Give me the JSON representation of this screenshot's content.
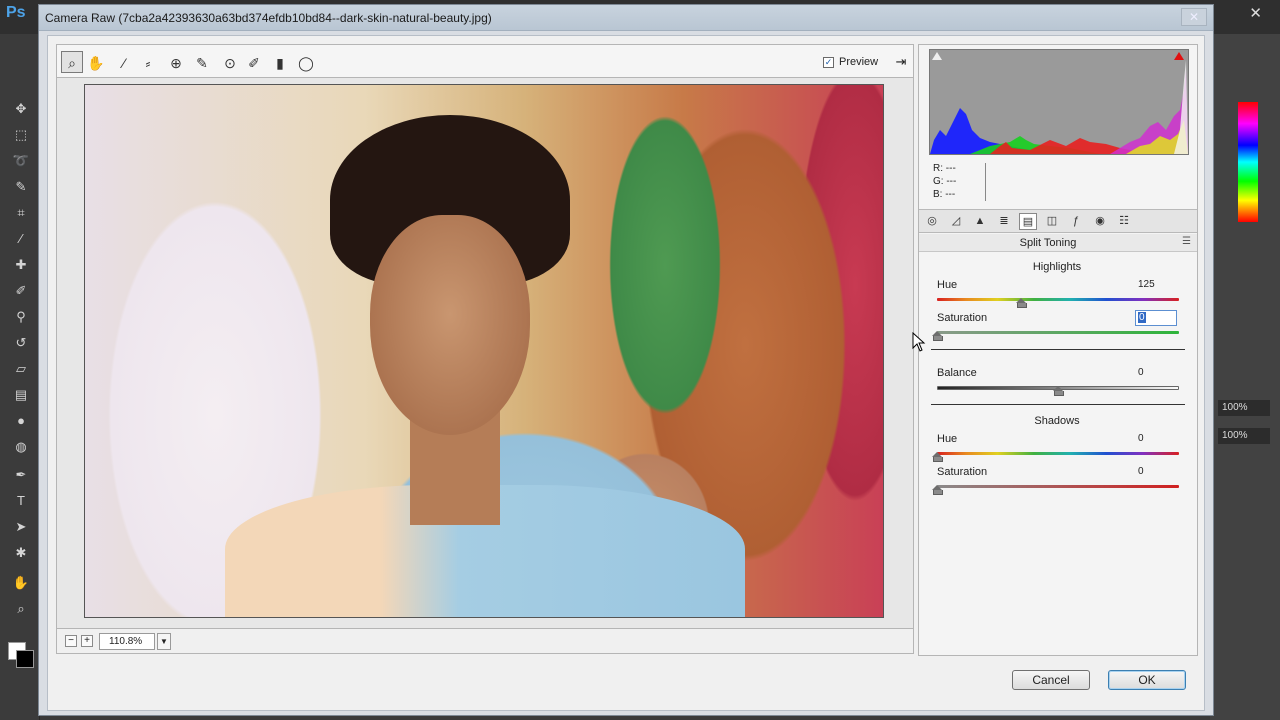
{
  "app": {
    "logo": "Ps",
    "window_close": "✕",
    "percent_1": "100%",
    "percent_2": "100%"
  },
  "dialog": {
    "title": "Camera Raw (7cba2a42393630a63bd374efdb10bd84--dark-skin-natural-beauty.jpg)",
    "close_glyph": "✕"
  },
  "toolbar": {
    "tools": [
      "zoom-icon",
      "hand-icon",
      "white-balance-icon",
      "color-sampler-icon",
      "targeted-adjustment-icon",
      "straighten-icon",
      "spot-removal-icon",
      "adjustment-brush-icon",
      "graduated-filter-icon",
      "radial-filter-icon"
    ],
    "preview_checked": true,
    "preview_label": "Preview"
  },
  "zoom": {
    "minus": "−",
    "plus": "+",
    "level": "110.8%"
  },
  "readout": {
    "r": "R:   ---",
    "g": "G:   ---",
    "b": "B:   ---"
  },
  "panel": {
    "title": "Split Toning",
    "menu_glyph": "☰",
    "highlights": {
      "title": "Highlights",
      "hue_label": "Hue",
      "hue_value": "125",
      "hue_fraction": 0.347,
      "saturation_label": "Saturation",
      "saturation_value": "0",
      "saturation_fraction": 0.0
    },
    "balance": {
      "label": "Balance",
      "value": "0",
      "fraction": 0.5
    },
    "shadows": {
      "title": "Shadows",
      "hue_label": "Hue",
      "hue_value": "0",
      "hue_fraction": 0.0,
      "saturation_label": "Saturation",
      "saturation_value": "0",
      "saturation_fraction": 0.0
    }
  },
  "buttons": {
    "cancel": "Cancel",
    "ok": "OK"
  },
  "colors": {
    "accent": "#316ac5",
    "clip_highlight": "#e01010"
  }
}
